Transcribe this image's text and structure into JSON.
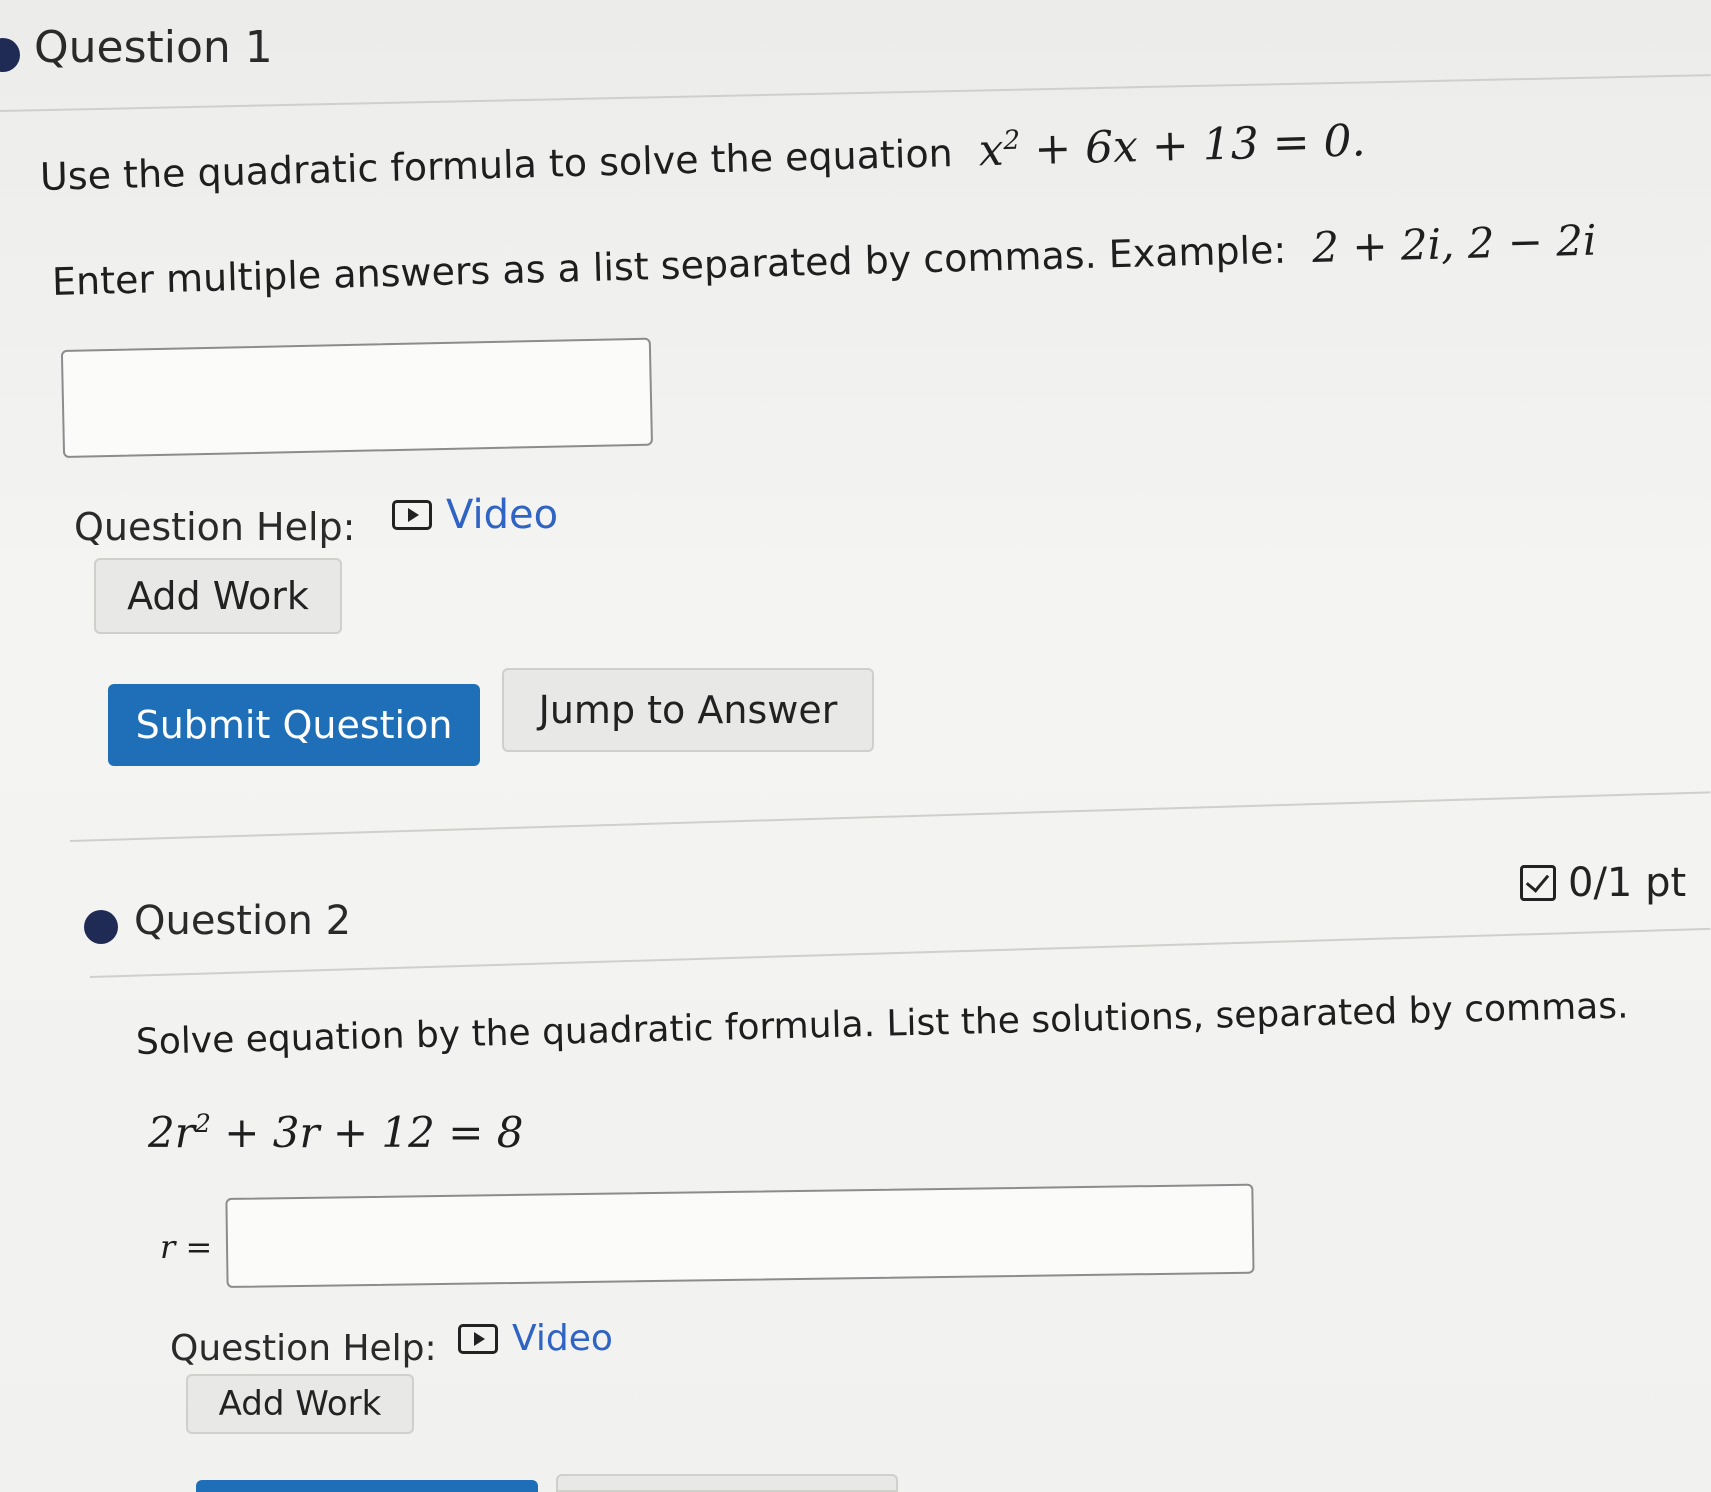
{
  "question1": {
    "title": "Question 1",
    "instruction_text": "Use the quadratic formula to solve the equation",
    "equation": {
      "a": "x",
      "exp": "2",
      "rest": " + 6x + 13 = 0."
    },
    "multi_answer_text": "Enter multiple answers as a list separated by commas. Example:",
    "example": "2 + 2i, 2 − 2i",
    "answer_value": "",
    "help_label": "Question Help:",
    "video_label": "Video",
    "add_work_label": "Add Work",
    "submit_label": "Submit Question",
    "jump_label": "Jump to Answer"
  },
  "question2": {
    "title": "Question 2",
    "score": "0/1 pt",
    "instruction_text": "Solve equation by the quadratic formula. List the solutions, separated by commas.",
    "equation": {
      "a": "2r",
      "exp": "2",
      "rest": " + 3r + 12 = 8"
    },
    "answer_prefix": "r =",
    "answer_value": "",
    "help_label": "Question Help:",
    "video_label": "Video",
    "add_work_label": "Add Work"
  },
  "colors": {
    "accent_blue": "#1f6fb8",
    "link_blue": "#2f63c4",
    "bullet": "#1f2a55"
  }
}
